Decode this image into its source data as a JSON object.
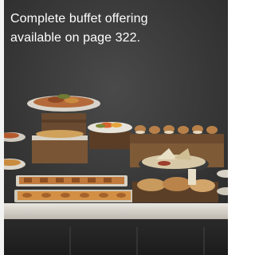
{
  "caption": {
    "line1": "Complete buffet offering",
    "line2": "available on page 322."
  }
}
